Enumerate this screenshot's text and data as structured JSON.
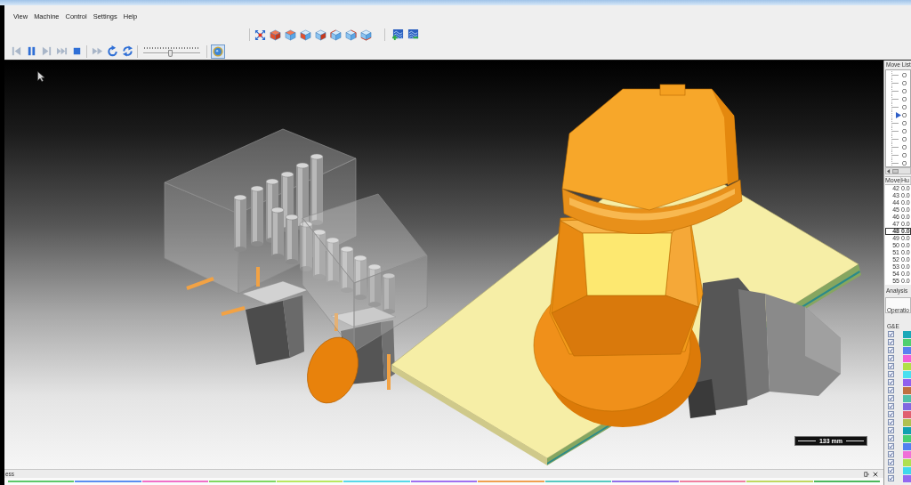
{
  "menu_bar": {
    "items": [
      "View",
      "Machine",
      "Control",
      "Settings",
      "Help"
    ]
  },
  "view_toolbar": {
    "buttons": [
      {
        "kind": "fit"
      },
      {
        "kind": "iso"
      },
      {
        "kind": "top"
      },
      {
        "kind": "front"
      },
      {
        "kind": "right"
      },
      {
        "kind": "left"
      },
      {
        "kind": "back"
      },
      {
        "kind": "bottom"
      }
    ],
    "path_buttons": [
      {
        "kind": "add"
      },
      {
        "kind": "remove"
      }
    ]
  },
  "playback_toolbar": {
    "groups": [
      {
        "buttons": [
          {
            "kind": "skip-start",
            "disabled": true
          },
          {
            "kind": "pause",
            "disabled": false
          },
          {
            "kind": "step-forward",
            "disabled": true
          },
          {
            "kind": "skip-end",
            "disabled": true
          },
          {
            "kind": "stop",
            "disabled": false
          }
        ]
      },
      {
        "buttons": [
          {
            "kind": "fast-forward",
            "disabled": true
          },
          {
            "kind": "rotate",
            "disabled": false
          },
          {
            "kind": "loop",
            "disabled": false
          }
        ]
      }
    ],
    "slider": {
      "level": 0.48
    },
    "toggle": {
      "pressed": true
    }
  },
  "viewport": {
    "scale_bar": {
      "label": "133 mm"
    }
  },
  "bottom_panel": {
    "title": "ess",
    "timeline": [
      {
        "color": "#5cc86a"
      },
      {
        "color": "#5a8ef0"
      },
      {
        "color": "#f070c8"
      },
      {
        "color": "#80d860"
      },
      {
        "color": "#b8e860"
      },
      {
        "color": "#58d8e8"
      },
      {
        "color": "#a070f0"
      },
      {
        "color": "#f0a050"
      },
      {
        "color": "#58c8c0"
      },
      {
        "color": "#9070e8"
      },
      {
        "color": "#f080a0"
      },
      {
        "color": "#c0d860"
      },
      {
        "color": "#4cb85c"
      }
    ]
  },
  "move_list": {
    "title": "Move List",
    "items": [
      {
        "label": "O",
        "current": false
      },
      {
        "label": "O",
        "current": false
      },
      {
        "label": "O",
        "current": false
      },
      {
        "label": "O",
        "current": false
      },
      {
        "label": "O",
        "current": false
      },
      {
        "label": "O",
        "current": true
      },
      {
        "label": "O",
        "current": false
      },
      {
        "label": "O",
        "current": false
      },
      {
        "label": "O",
        "current": false
      },
      {
        "label": "O",
        "current": false
      },
      {
        "label": "O",
        "current": false
      },
      {
        "label": "O",
        "current": false
      }
    ]
  },
  "moves_table": {
    "columns": [
      "Move",
      "Hu"
    ],
    "rows": [
      {
        "cells": [
          "42",
          "0.0"
        ],
        "selected": false
      },
      {
        "cells": [
          "43",
          "0.0"
        ],
        "selected": false
      },
      {
        "cells": [
          "44",
          "0.0"
        ],
        "selected": false
      },
      {
        "cells": [
          "45",
          "0.0"
        ],
        "selected": false
      },
      {
        "cells": [
          "46",
          "0.0"
        ],
        "selected": false
      },
      {
        "cells": [
          "47",
          "0.0"
        ],
        "selected": false
      },
      {
        "cells": [
          "48",
          "0.0"
        ],
        "selected": true
      },
      {
        "cells": [
          "49",
          "0.0"
        ],
        "selected": false
      },
      {
        "cells": [
          "50",
          "0.0"
        ],
        "selected": false
      },
      {
        "cells": [
          "51",
          "0.0"
        ],
        "selected": false
      },
      {
        "cells": [
          "52",
          "0.0"
        ],
        "selected": false
      },
      {
        "cells": [
          "53",
          "0.0"
        ],
        "selected": false
      },
      {
        "cells": [
          "54",
          "0.0"
        ],
        "selected": false
      },
      {
        "cells": [
          "55",
          "0.0"
        ],
        "selected": false
      }
    ]
  },
  "analysis": {
    "title": "Analysis",
    "tab": "Operatio",
    "column": "G&E",
    "rows": [
      {
        "checked": true,
        "color": "#1aa8b8"
      },
      {
        "checked": true,
        "color": "#50d070"
      },
      {
        "checked": true,
        "color": "#5a80f0"
      },
      {
        "checked": true,
        "color": "#f060d8"
      },
      {
        "checked": true,
        "color": "#b0e048"
      },
      {
        "checked": true,
        "color": "#48e0f0"
      },
      {
        "checked": true,
        "color": "#9060f0"
      },
      {
        "checked": true,
        "color": "#c07040"
      },
      {
        "checked": true,
        "color": "#50c0a8"
      },
      {
        "checked": true,
        "color": "#8068e0"
      },
      {
        "checked": true,
        "color": "#e06070"
      },
      {
        "checked": true,
        "color": "#b0c050"
      },
      {
        "checked": true,
        "color": "#10a0b0"
      },
      {
        "checked": true,
        "color": "#48d070"
      },
      {
        "checked": true,
        "color": "#5080f0"
      },
      {
        "checked": true,
        "color": "#f070d8"
      },
      {
        "checked": true,
        "color": "#b0e050"
      },
      {
        "checked": true,
        "color": "#40d8ec"
      },
      {
        "checked": true,
        "color": "#9468f0"
      }
    ]
  }
}
